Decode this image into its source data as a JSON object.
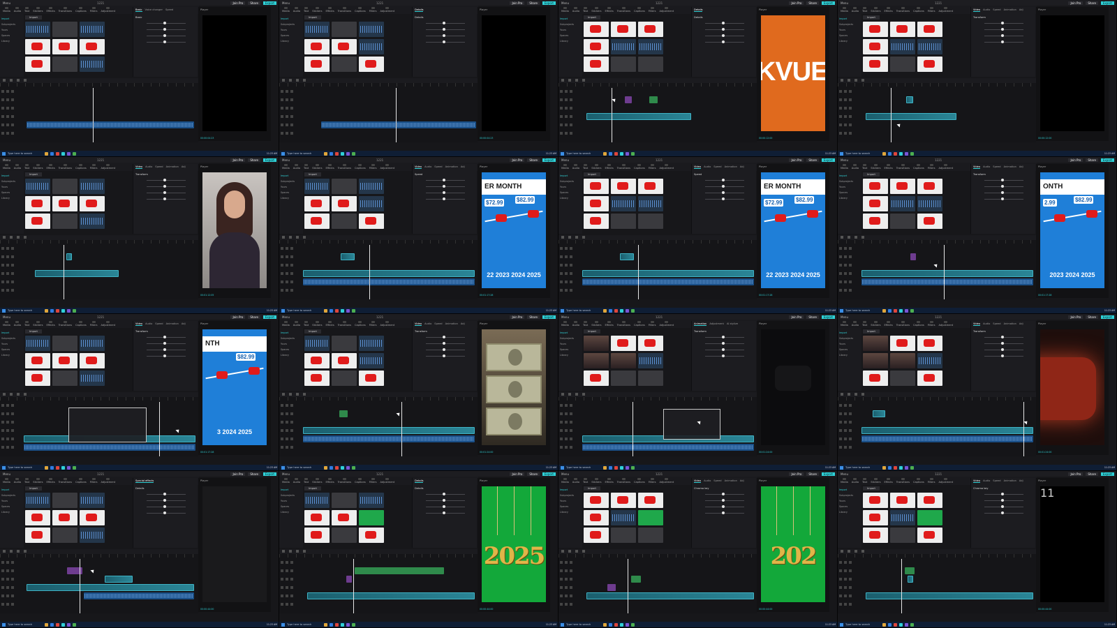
{
  "app": {
    "menu_label": "Menu",
    "project": "1221",
    "join_label": "Join Pro",
    "share_label": "Share",
    "export_label": "Export",
    "toolbar_tabs": [
      "Media",
      "Audio",
      "Text",
      "Stickers",
      "Effects",
      "Transitions",
      "Captions",
      "Filters",
      "Adjustment"
    ],
    "sidebar_items": [
      "Import",
      "Subprojects",
      "Yours",
      "Spaces",
      "Library"
    ],
    "import_label": "Import",
    "player_label": "Player",
    "taskbar_search": "Type here to search",
    "accent": "#2fd1d6"
  },
  "tiles": [
    {
      "screen": "black",
      "panel": [
        "Basic",
        "Voice changer",
        "Speed"
      ],
      "section": "Basic",
      "timecode": "00:00:04:23"
    },
    {
      "screen": "black",
      "panel": [
        "Details"
      ],
      "section": "Details",
      "timecode": "00:00:04:23"
    },
    {
      "screen": "orange",
      "screen_text": "KVUE",
      "panel": [
        "Details"
      ],
      "section": "Details",
      "timecode": "00:00:12:00"
    },
    {
      "screen": "black",
      "panel": [
        "Video",
        "Audio",
        "Speed",
        "Animation",
        "Adj"
      ],
      "section": "Transform",
      "timecode": "00:00:12:00"
    },
    {
      "screen": "woman",
      "panel": [
        "Video",
        "Audio",
        "Speed",
        "Animation",
        "Adj"
      ],
      "section": "Transform",
      "timecode": "00:01:12:05"
    },
    {
      "screen": "blue",
      "banner": "ER MONTH",
      "prices": [
        "$72.99",
        "$82.99"
      ],
      "years": "22 2023 2024 2025",
      "panel": [
        "Video",
        "Audio",
        "Speed",
        "Animation",
        "Adj"
      ],
      "section": "Speed",
      "timecode": "00:01:17:28"
    },
    {
      "screen": "blue",
      "banner": "ER MONTH",
      "prices": [
        "$72.99",
        "$82.99"
      ],
      "years": "22 2023 2024 2025",
      "panel": [
        "Video",
        "Audio",
        "Speed",
        "Animation",
        "Adj"
      ],
      "section": "Speed",
      "timecode": "00:01:17:28"
    },
    {
      "screen": "blue",
      "banner": "ONTH",
      "prices": [
        "2.99",
        "$82.99"
      ],
      "years": "2023 2024 2025",
      "panel": [
        "Video",
        "Audio",
        "Speed",
        "Animation",
        "Adj"
      ],
      "section": "Transform",
      "timecode": "00:01:17:28"
    },
    {
      "screen": "blue",
      "banner": "NTH",
      "prices": [
        "",
        "$82.99"
      ],
      "years": "3 2024 2025",
      "panel": [
        "Video",
        "Audio",
        "Speed",
        "Animation",
        "Adj"
      ],
      "section": "Transform",
      "timecode": "00:01:17:28"
    },
    {
      "screen": "money",
      "panel": [
        "Video",
        "Audio",
        "Speed",
        "Animation",
        "Adj"
      ],
      "section": "Transform",
      "timecode": "00:01:24:00"
    },
    {
      "screen": "dark",
      "panel": [
        "Animation",
        "Adjustment",
        "AI stylize"
      ],
      "section": "Transform",
      "timecode": "00:01:24:00"
    },
    {
      "screen": "red",
      "panel": [
        "Video",
        "Audio",
        "Speed",
        "Animation",
        "Adj"
      ],
      "section": "Transform",
      "timecode": "00:01:24:00"
    },
    {
      "screen": "empty",
      "panel": [
        "Special effects"
      ],
      "section": "Details",
      "timecode": "00:00:44:00"
    },
    {
      "screen": "green",
      "screen_text": "2025",
      "panel": [
        "Details"
      ],
      "section": "Details",
      "timecode": "00:00:44:00"
    },
    {
      "screen": "green",
      "screen_text": "202",
      "panel": [
        "Video",
        "Audio",
        "Speed",
        "Animation",
        "Adj"
      ],
      "section": "Chroma key",
      "timecode": "00:00:44:00"
    },
    {
      "screen": "calendar",
      "screen_text": "11",
      "panel": [
        "Video",
        "Audio",
        "Speed",
        "Animation",
        "Adj"
      ],
      "section": "Chroma key",
      "timecode": "00:00:44:00"
    }
  ],
  "taskbar": {
    "time": "11:23 AM"
  }
}
